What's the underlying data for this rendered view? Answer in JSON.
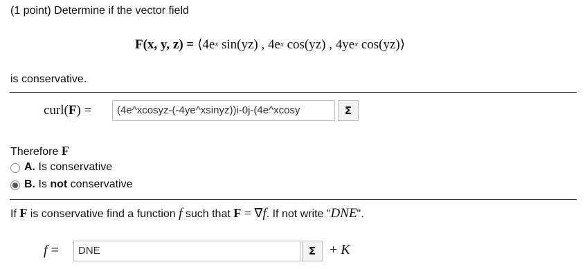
{
  "problem": {
    "intro": "(1 point) Determine if the vector field",
    "field_lhs": "F(x, y, z) =",
    "field_rhs_parts": {
      "open": "⟨4e",
      "exp1": "x",
      "c1": " sin(yz) , 4e",
      "exp2": "x",
      "c2": " cos(yz) , 4ye",
      "exp3": "x",
      "close": " cos(yz)⟩"
    },
    "is_conservative_text": "is conservative."
  },
  "curl": {
    "label_func": "curl(",
    "label_F": "F",
    "label_end": ") =",
    "input_value": "(4e^xcosyz-(-4ye^xsinyz))i-0j-(4e^xcosy",
    "sigma_label": "Σ"
  },
  "therefore": {
    "prefix": "Therefore ",
    "F": "F",
    "options": [
      {
        "letter": "A.",
        "text_pre": "Is conservative",
        "text_bold": "",
        "text_post": "",
        "selected": false
      },
      {
        "letter": "B.",
        "text_pre": "Is ",
        "text_bold": "not",
        "text_post": " conservative",
        "selected": true
      }
    ]
  },
  "potential": {
    "q_pre": "If ",
    "q_F": "F",
    "q_mid": " is conservative find a function ",
    "q_f": "f",
    "q_mid2": " such that ",
    "q_F2": "F",
    "q_eq": " = ∇",
    "q_f2": "f",
    "q_post": ". If not write \"",
    "q_dne": "DNE",
    "q_end": "\".",
    "f_label": "f",
    "eq": "=",
    "input_value": "DNE",
    "sigma_label": "Σ",
    "plus": "+",
    "K": "K"
  }
}
